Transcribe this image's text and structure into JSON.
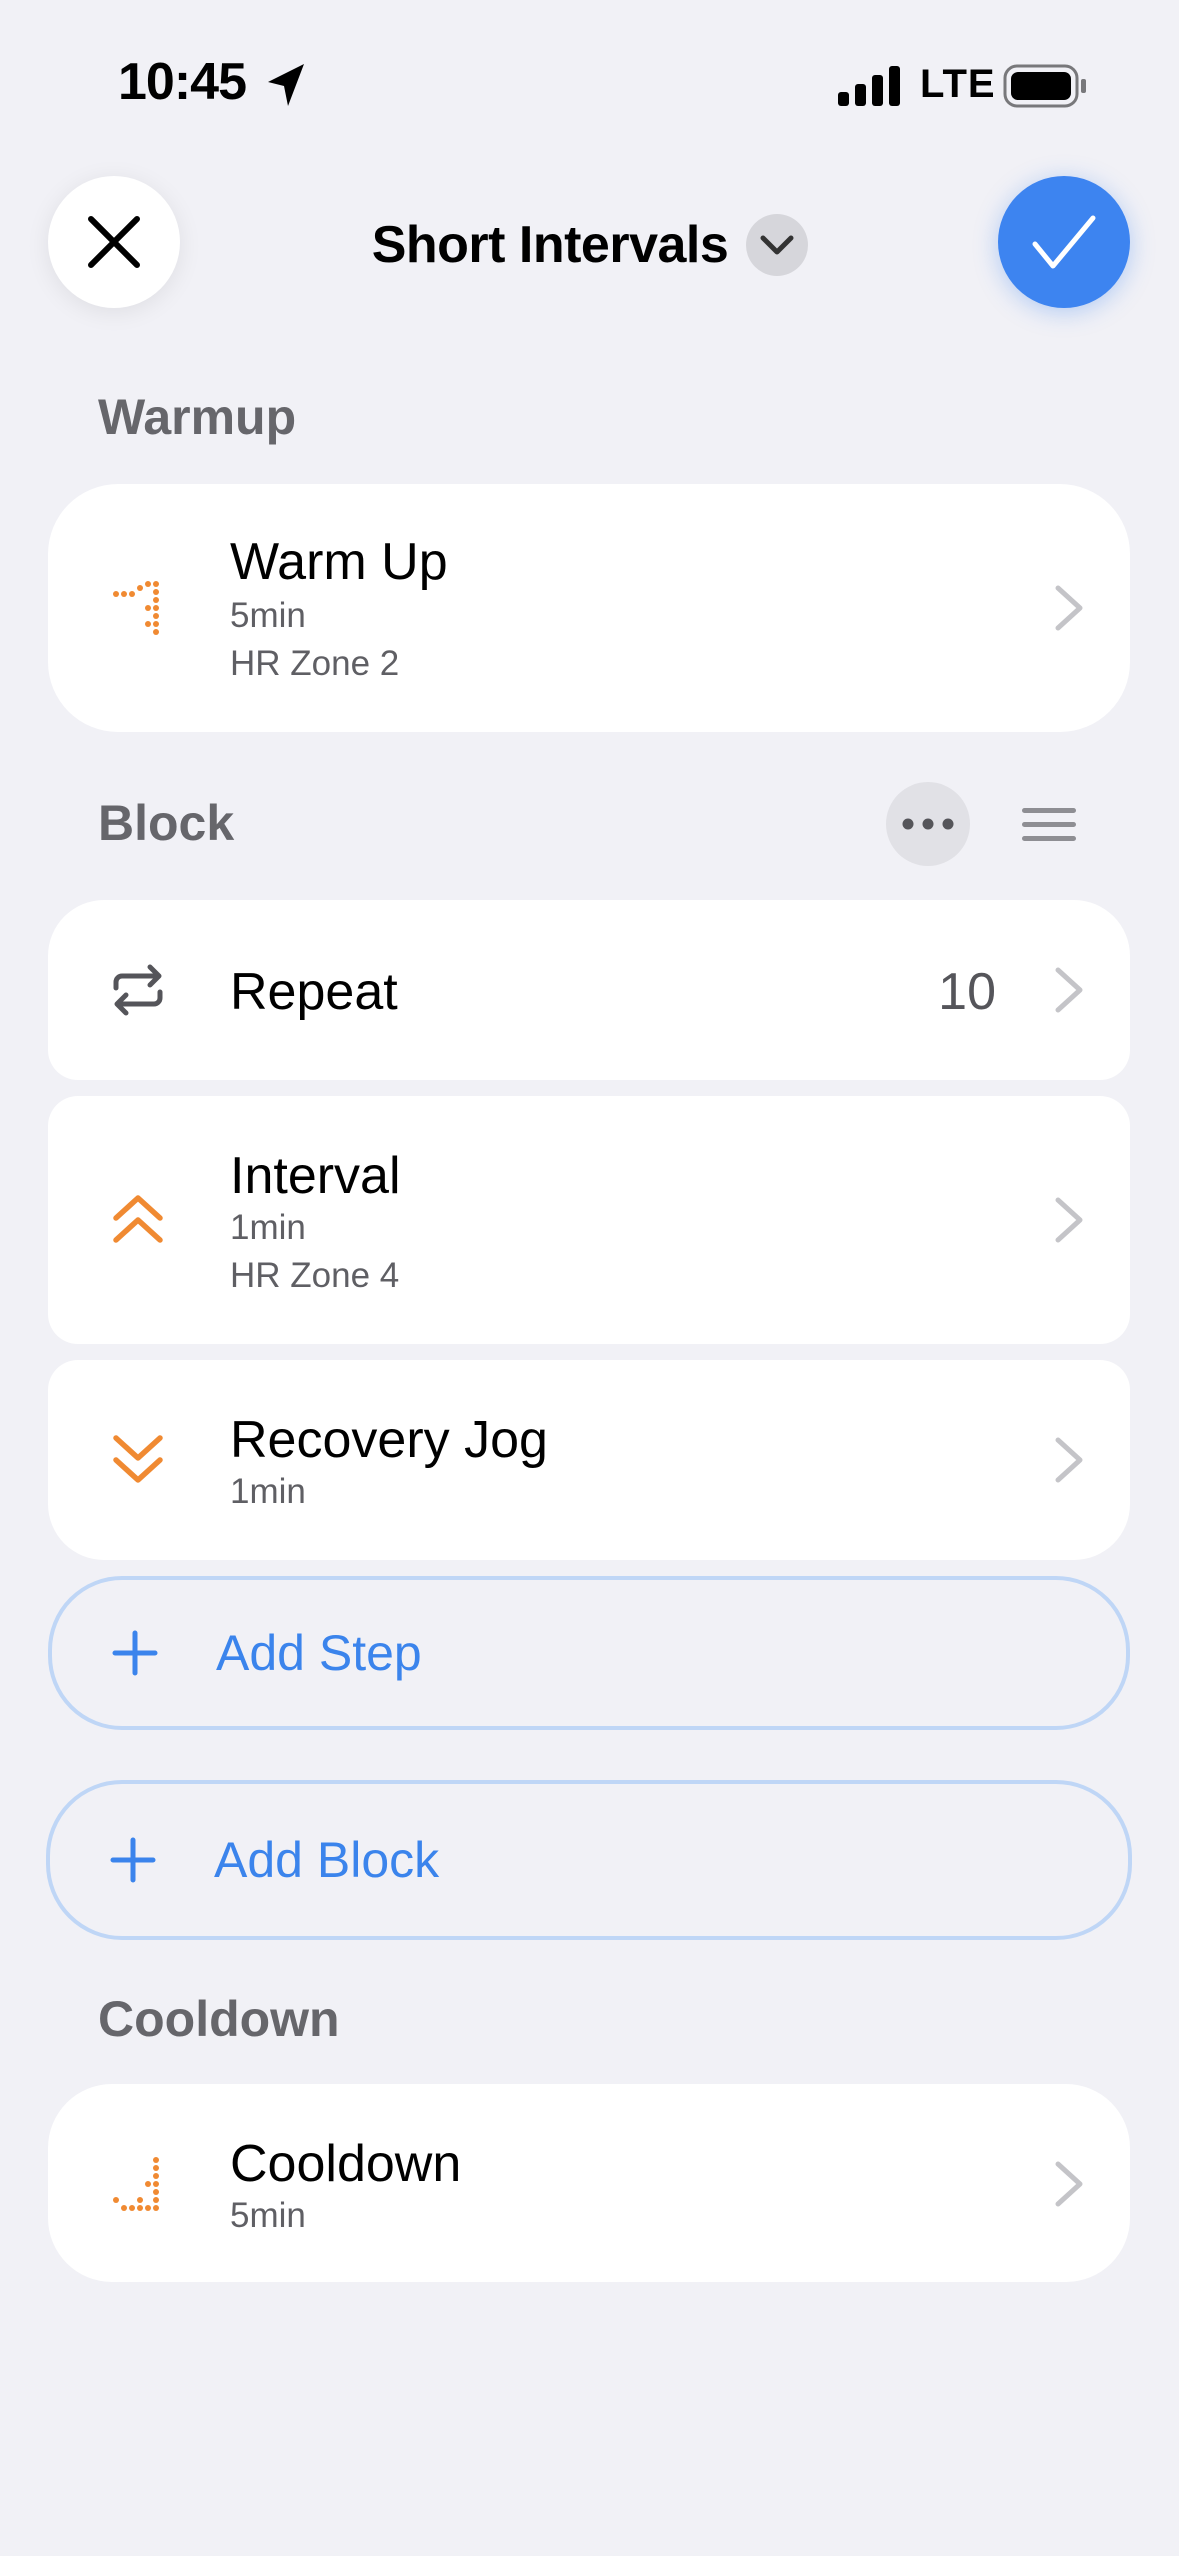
{
  "status_bar": {
    "time": "10:45",
    "network": "LTE"
  },
  "nav": {
    "title": "Short Intervals"
  },
  "sections": {
    "warmup": {
      "header": "Warmup",
      "step": {
        "title": "Warm Up",
        "duration": "5min",
        "target": "HR Zone 2"
      }
    },
    "block": {
      "header": "Block",
      "repeat": {
        "label": "Repeat",
        "count": "10"
      },
      "interval": {
        "title": "Interval",
        "duration": "1min",
        "target": "HR Zone 4"
      },
      "recovery": {
        "title": "Recovery Jog",
        "duration": "1min"
      },
      "add_step_label": "Add Step"
    },
    "add_block_label": "Add Block",
    "cooldown": {
      "header": "Cooldown",
      "step": {
        "title": "Cooldown",
        "duration": "5min"
      }
    }
  },
  "colors": {
    "accent": "#3d84f0",
    "step_icon": "#f08a32",
    "background": "#f1f1f6"
  }
}
